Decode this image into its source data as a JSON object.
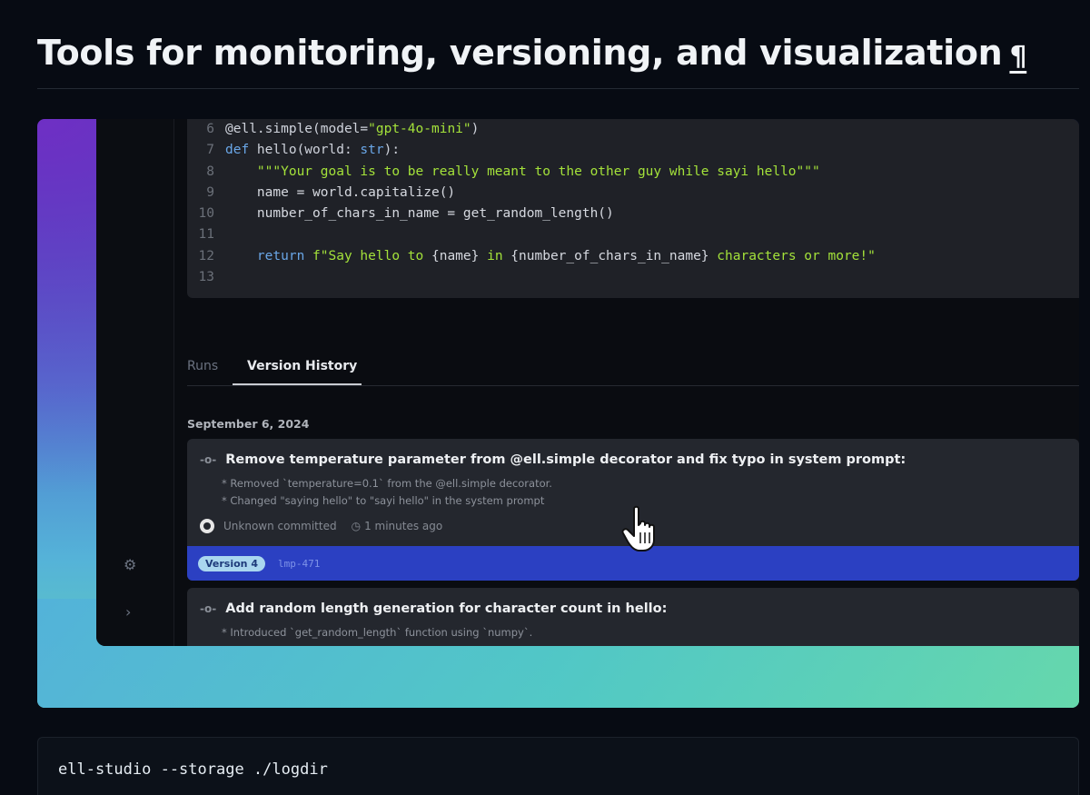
{
  "heading": {
    "title": "Tools for monitoring, versioning, and visualization",
    "anchor": "¶"
  },
  "code": {
    "lines": [
      {
        "n": "6",
        "parts": [
          {
            "c": "fn",
            "t": "@ell.simple(model="
          },
          {
            "c": "str",
            "t": "\"gpt-4o-mini\""
          },
          {
            "c": "fn",
            "t": ")"
          }
        ]
      },
      {
        "n": "7",
        "parts": [
          {
            "c": "kw",
            "t": "def "
          },
          {
            "c": "fn",
            "t": "hello(world: "
          },
          {
            "c": "kw",
            "t": "str"
          },
          {
            "c": "fn",
            "t": "):"
          }
        ]
      },
      {
        "n": "8",
        "parts": [
          {
            "c": "str",
            "t": "    \"\"\"Your goal is to be really meant to the other guy while sayi hello\"\"\""
          }
        ]
      },
      {
        "n": "9",
        "parts": [
          {
            "c": "plain",
            "t": "    name = world.capitalize()"
          }
        ]
      },
      {
        "n": "10",
        "parts": [
          {
            "c": "plain",
            "t": "    number_of_chars_in_name = get_random_length()"
          }
        ]
      },
      {
        "n": "11",
        "parts": []
      },
      {
        "n": "12",
        "parts": [
          {
            "c": "kw",
            "t": "    return "
          },
          {
            "c": "str",
            "t": "f\"Say hello to "
          },
          {
            "c": "plain",
            "t": "{name}"
          },
          {
            "c": "str",
            "t": " in "
          },
          {
            "c": "plain",
            "t": "{number_of_chars_in_name}"
          },
          {
            "c": "str",
            "t": " characters or more!\""
          }
        ]
      },
      {
        "n": "13",
        "parts": []
      }
    ]
  },
  "tabs": {
    "runs": "Runs",
    "version_history": "Version History"
  },
  "history": {
    "date": "September 6, 2024",
    "commit1": {
      "title": "Remove temperature parameter from @ell.simple decorator and fix typo in system prompt:",
      "bullet1": "* Removed `temperature=0.1` from the @ell.simple decorator.",
      "bullet2": "* Changed \"saying hello\" to \"sayi hello\" in the system prompt",
      "author": "Unknown committed",
      "time": "1 minutes ago",
      "version": "Version 4",
      "hash": "lmp-471"
    },
    "commit2": {
      "title": "Add random length generation for character count in hello:",
      "bullet1": "* Introduced `get_random_length` function using `numpy`."
    }
  },
  "icons": {
    "settings": "gear-icon",
    "expand": "chevron-right-icon",
    "commit": "commit-icon",
    "github": "github-icon",
    "clock": "clock-icon",
    "cursor": "hand-cursor-icon"
  },
  "command": {
    "text": "ell-studio --storage ./logdir"
  }
}
